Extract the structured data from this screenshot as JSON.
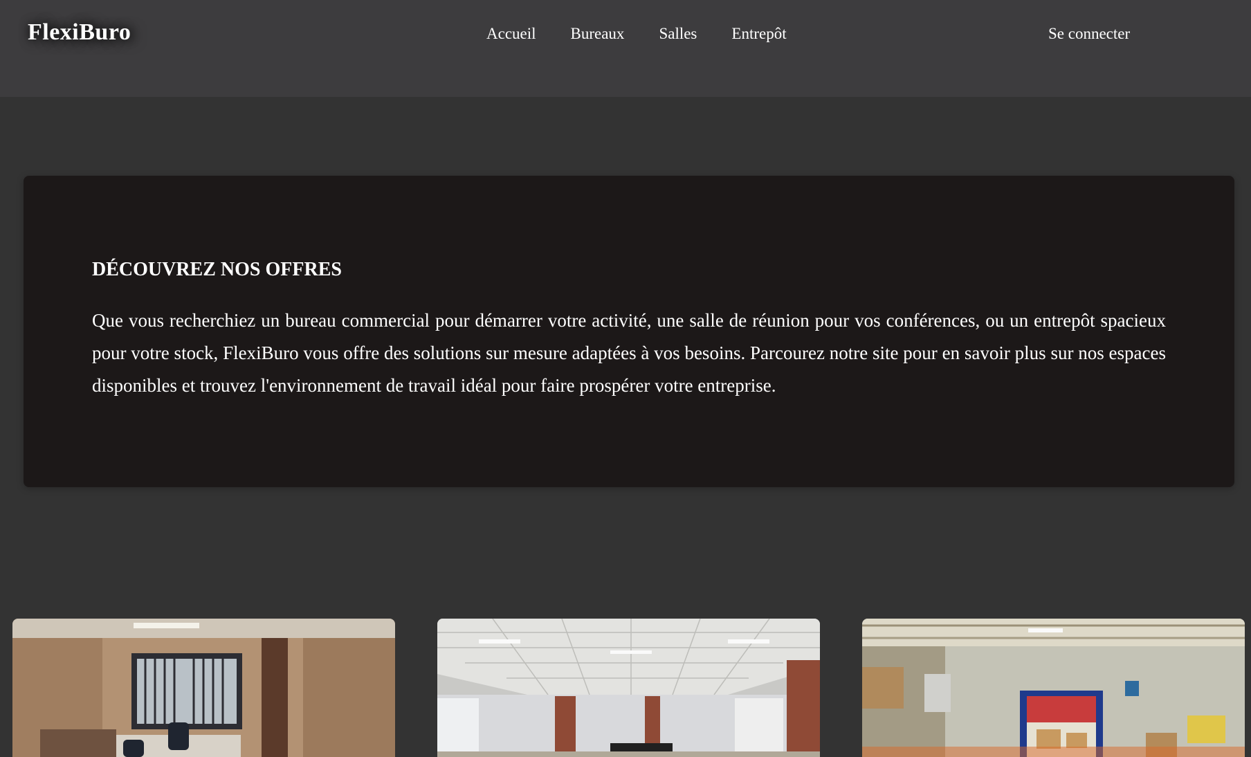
{
  "header": {
    "logo": "FlexiBuro",
    "nav": [
      "Accueil",
      "Bureaux",
      "Salles",
      "Entrepôt"
    ],
    "login": "Se connecter"
  },
  "hero": {
    "title": "DÉCOUVREZ NOS OFFRES",
    "text": "Que vous recherchiez un bureau commercial pour démarrer votre activité, une salle de réunion pour vos conférences, ou un entrepôt spacieux pour votre stock, FlexiBuro vous offre des solutions sur mesure adaptées à vos besoins. Parcourez notre site pour en savoir plus sur nos espaces disponibles et trouvez l'environnement de travail idéal pour faire prospérer votre entreprise."
  },
  "colors": {
    "page_background": "#333333",
    "header_background": "#3d3c3e",
    "hero_background": "#1c1818",
    "text": "#ffffff"
  }
}
